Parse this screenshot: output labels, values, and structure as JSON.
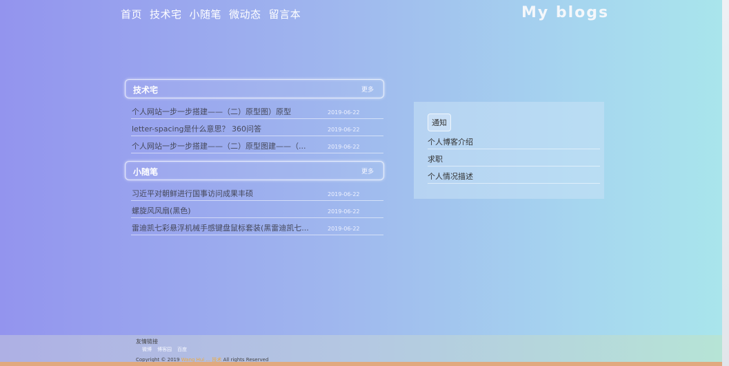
{
  "nav": {
    "items": [
      "首页",
      "技术宅",
      "小随笔",
      "微动态",
      "留言本"
    ],
    "brand": "My blogs"
  },
  "sections": [
    {
      "title": "技术宅",
      "more": "更多",
      "articles": [
        {
          "title": "个人网站一步一步搭建——（二）原型图）原型",
          "date": "2019-06-22"
        },
        {
          "title": "letter-spacing是什么意思？ 360问答",
          "date": "2019-06-22"
        },
        {
          "title": "个人网站一步一步搭建——（二）原型图建——（...",
          "date": "2019-06-22"
        }
      ]
    },
    {
      "title": "小随笔",
      "more": "更多",
      "articles": [
        {
          "title": "习近平对朝鲜进行国事访问成果丰硕",
          "date": "2019-06-22"
        },
        {
          "title": "螺旋风风扇(黑色)",
          "date": "2019-06-22"
        },
        {
          "title": "雷迪凯七彩悬浮机械手感键盘鼠标套装(黑雷迪凯七...",
          "date": "2019-06-22"
        }
      ]
    }
  ],
  "notice": {
    "title": "通知",
    "items": [
      "个人博客介绍",
      "求职",
      "个人情况描述"
    ]
  },
  "footer": {
    "links_title": "友情链接",
    "links": [
      "微博",
      "博客园",
      "百度"
    ],
    "copyright_prefix": "Copyright © 2019",
    "copyright_highlight": "Wang Hui ... 技术",
    "copyright_suffix": "All rights Reserved"
  }
}
